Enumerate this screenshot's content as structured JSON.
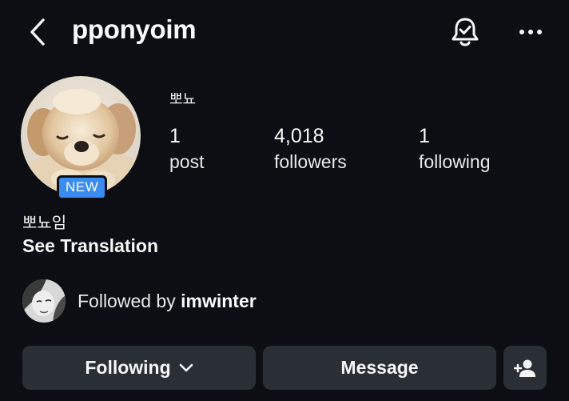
{
  "header": {
    "username": "pponyoim",
    "icons": {
      "back": "chevron-left-icon",
      "bell": "notification-bell-check-icon",
      "more": "more-horizontal-icon"
    }
  },
  "profile": {
    "display_name": "뽀뇨",
    "badge": "NEW",
    "stats": {
      "posts": {
        "count": "1",
        "label": "post"
      },
      "followers": {
        "count": "4,018",
        "label": "followers"
      },
      "following": {
        "count": "1",
        "label": "following"
      }
    },
    "bio_name": "뽀뇨임",
    "see_translation": "See Translation"
  },
  "followed_by": {
    "prefix": "Followed by",
    "user": "imwinter"
  },
  "actions": {
    "following_label": "Following",
    "message_label": "Message",
    "add_user_icon": "add-person-icon"
  },
  "colors": {
    "background": "#0c0e13",
    "button": "#2a2f36",
    "badge": "#3b8cf0"
  }
}
